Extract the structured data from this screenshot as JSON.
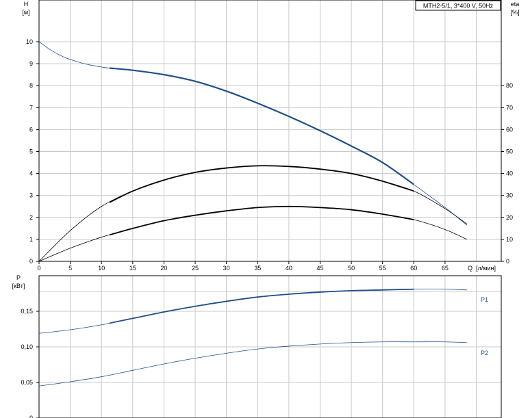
{
  "chart_data": [
    {
      "type": "line",
      "title": "MTH2-5/1, 3*400 V, 50Hz",
      "x_label": "Q",
      "x_unit": "[л/мин]",
      "x_ticks": [
        "0",
        "5",
        "10",
        "15",
        "20",
        "25",
        "30",
        "35",
        "40",
        "45",
        "50",
        "55",
        "60",
        "65"
      ],
      "xlim": [
        0,
        74
      ],
      "left_axis": {
        "label": "H",
        "unit": "[м]",
        "ticks": [
          "0",
          "1",
          "2",
          "3",
          "4",
          "5",
          "6",
          "7",
          "8",
          "9",
          "10"
        ],
        "ylim": [
          0,
          11.9
        ]
      },
      "right_axis": {
        "label": "eta",
        "unit": "[%]",
        "ticks": [
          "0",
          "10",
          "20",
          "30",
          "40",
          "50",
          "60",
          "70",
          "80"
        ],
        "ylim": [
          0,
          119
        ]
      },
      "grid": true,
      "series": [
        {
          "axis": "left",
          "color": "#1f4e8c",
          "x": [
            0,
            2,
            4,
            6,
            8,
            10,
            11.3,
            15,
            20,
            25,
            30,
            35,
            40,
            45,
            50,
            55,
            60,
            65,
            68.5
          ],
          "y": [
            10.0,
            9.6,
            9.3,
            9.1,
            8.95,
            8.85,
            8.8,
            8.7,
            8.5,
            8.2,
            7.75,
            7.2,
            6.6,
            5.95,
            5.25,
            4.5,
            3.5,
            2.45,
            1.65
          ],
          "highlight_x": [
            11.3,
            60
          ]
        },
        {
          "axis": "right",
          "color": "#000000",
          "x": [
            0,
            5,
            10,
            15,
            20,
            25,
            30,
            35,
            40,
            45,
            50,
            55,
            60,
            65,
            68.5
          ],
          "y": [
            0,
            14,
            25,
            32,
            37,
            40.5,
            42.5,
            43.5,
            43.2,
            42,
            40,
            36.5,
            32,
            24,
            17
          ],
          "highlight_x": [
            11.3,
            60
          ]
        },
        {
          "axis": "left",
          "color": "#000000",
          "x": [
            0,
            5,
            10,
            15,
            20,
            25,
            30,
            35,
            40,
            45,
            50,
            55,
            60,
            65,
            68.5
          ],
          "y": [
            0,
            0.6,
            1.1,
            1.5,
            1.85,
            2.1,
            2.3,
            2.45,
            2.5,
            2.45,
            2.35,
            2.15,
            1.9,
            1.45,
            1.0
          ],
          "highlight_x": [
            11.3,
            60
          ]
        }
      ]
    },
    {
      "type": "line",
      "y_label": "P",
      "y_unit": "[кВт]",
      "y_ticks": [
        "0",
        "0,05",
        "0,10",
        "0,15"
      ],
      "ylim": [
        0,
        0.2
      ],
      "xlim": [
        0,
        74
      ],
      "grid": true,
      "series": [
        {
          "name": "P1",
          "color": "#1f4e8c",
          "x": [
            0,
            5,
            10,
            15,
            20,
            25,
            30,
            35,
            40,
            45,
            50,
            55,
            60,
            65,
            68.5
          ],
          "y": [
            0.119,
            0.124,
            0.131,
            0.14,
            0.149,
            0.157,
            0.164,
            0.17,
            0.174,
            0.177,
            0.179,
            0.18,
            0.181,
            0.181,
            0.18
          ],
          "highlight_x": [
            11.3,
            60
          ]
        },
        {
          "name": "P2",
          "color": "#1f4e8c",
          "x": [
            0,
            5,
            10,
            15,
            20,
            25,
            30,
            35,
            40,
            45,
            50,
            55,
            60,
            65,
            68.5
          ],
          "y": [
            0.045,
            0.051,
            0.058,
            0.067,
            0.076,
            0.084,
            0.091,
            0.097,
            0.101,
            0.104,
            0.106,
            0.107,
            0.107,
            0.107,
            0.106
          ]
        }
      ]
    }
  ]
}
